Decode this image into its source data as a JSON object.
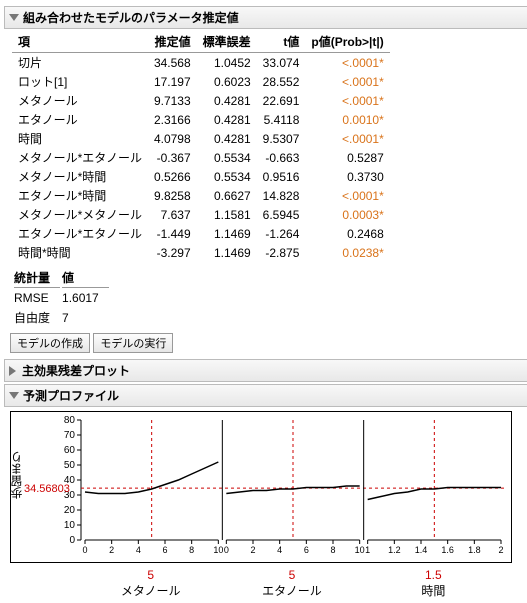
{
  "sections": {
    "params_title": "組み合わせたモデルのパラメータ推定値",
    "headers": {
      "term": "項",
      "est": "推定値",
      "se": "標準誤差",
      "t": "t値",
      "p": "p値(Prob>|t|)"
    },
    "rows": [
      {
        "term": "切片",
        "est": "34.568",
        "se": "1.0452",
        "t": "33.074",
        "p": "<.0001*",
        "sig": true
      },
      {
        "term": "ロット[1]",
        "est": "17.197",
        "se": "0.6023",
        "t": "28.552",
        "p": "<.0001*",
        "sig": true
      },
      {
        "term": "メタノール",
        "est": "9.7133",
        "se": "0.4281",
        "t": "22.691",
        "p": "<.0001*",
        "sig": true
      },
      {
        "term": "エタノール",
        "est": "2.3166",
        "se": "0.4281",
        "t": "5.4118",
        "p": "0.0010*",
        "sig": true
      },
      {
        "term": "時間",
        "est": "4.0798",
        "se": "0.4281",
        "t": "9.5307",
        "p": "<.0001*",
        "sig": true
      },
      {
        "term": "メタノール*エタノール",
        "est": "-0.367",
        "se": "0.5534",
        "t": "-0.663",
        "p": "0.5287",
        "sig": false
      },
      {
        "term": "メタノール*時間",
        "est": "0.5266",
        "se": "0.5534",
        "t": "0.9516",
        "p": "0.3730",
        "sig": false
      },
      {
        "term": "エタノール*時間",
        "est": "9.8258",
        "se": "0.6627",
        "t": "14.828",
        "p": "<.0001*",
        "sig": true
      },
      {
        "term": "メタノール*メタノール",
        "est": "7.637",
        "se": "1.1581",
        "t": "6.5945",
        "p": "0.0003*",
        "sig": true
      },
      {
        "term": "エタノール*エタノール",
        "est": "-1.449",
        "se": "1.1469",
        "t": "-1.264",
        "p": "0.2468",
        "sig": false
      },
      {
        "term": "時間*時間",
        "est": "-3.297",
        "se": "1.1469",
        "t": "-2.875",
        "p": "0.0238*",
        "sig": true
      }
    ],
    "stats_header": {
      "name": "統計量",
      "val": "値"
    },
    "stats": [
      {
        "name": "RMSE",
        "val": "1.6017"
      },
      {
        "name": "自由度",
        "val": "7"
      }
    ],
    "buttons": {
      "make": "モデルの作成",
      "run": "モデルの実行"
    },
    "resid_title": "主効果残差プロット",
    "profile_title": "予測プロファイル",
    "ylabel": "歩留まり",
    "yvalue": "34.56803"
  },
  "chart_data": {
    "type": "line",
    "title": "予測プロファイル",
    "ylabel": "歩留まり",
    "ylim": [
      0,
      80
    ],
    "yticks": [
      0,
      10,
      20,
      30,
      40,
      50,
      60,
      70,
      80
    ],
    "current_y": 34.56803,
    "panels": [
      {
        "name": "メタノール",
        "xlim": [
          0,
          10
        ],
        "xticks": [
          0,
          2,
          4,
          6,
          8,
          10
        ],
        "knob": 5,
        "series": {
          "x": [
            0,
            1,
            2,
            3,
            4,
            5,
            6,
            7,
            8,
            9,
            10
          ],
          "y": [
            32,
            31,
            31,
            31,
            32,
            34,
            37,
            40,
            44,
            48,
            52
          ]
        }
      },
      {
        "name": "エタノール",
        "xlim": [
          0,
          10
        ],
        "xticks": [
          0,
          2,
          4,
          6,
          8,
          10
        ],
        "knob": 5,
        "series": {
          "x": [
            0,
            1,
            2,
            3,
            4,
            5,
            6,
            7,
            8,
            9,
            10
          ],
          "y": [
            31,
            32,
            33,
            33,
            34,
            34,
            35,
            35,
            35,
            36,
            36
          ]
        }
      },
      {
        "name": "時間",
        "xlim": [
          1.0,
          2.0
        ],
        "xticks": [
          1.0,
          1.2,
          1.4,
          1.6,
          1.8,
          2.0
        ],
        "knob": 1.5,
        "series": {
          "x": [
            1.0,
            1.1,
            1.2,
            1.3,
            1.4,
            1.5,
            1.6,
            1.7,
            1.8,
            1.9,
            2.0
          ],
          "y": [
            27,
            29,
            31,
            32,
            34,
            34,
            35,
            35,
            35,
            35,
            35
          ]
        }
      }
    ]
  }
}
